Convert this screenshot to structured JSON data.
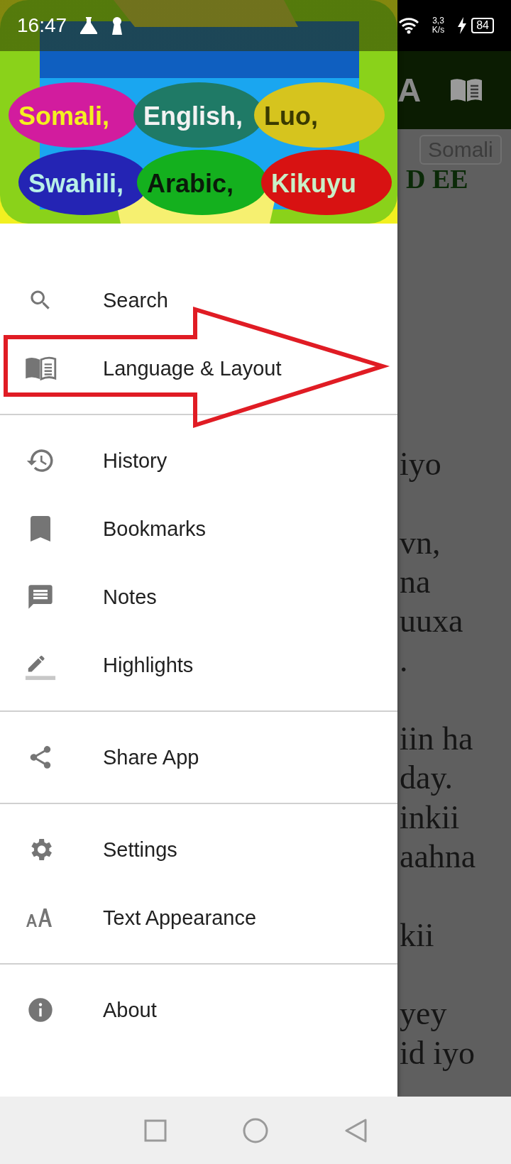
{
  "status_bar": {
    "time": "16:47",
    "net_speed": "3,3",
    "net_unit": "K/s",
    "battery": "84"
  },
  "banner": {
    "bubbles": [
      {
        "label": "Somali,",
        "color": "#d21c9e"
      },
      {
        "label": "English,",
        "color": "#1f7a66"
      },
      {
        "label": "Luo,",
        "color": "#d6c41e"
      },
      {
        "label": "Swahili,",
        "color": "#2424b4"
      },
      {
        "label": "Arabic,",
        "color": "#14b01e"
      },
      {
        "label": "Kikuyu",
        "color": "#d81212"
      }
    ]
  },
  "drawer": {
    "sections": [
      {
        "items": [
          {
            "kind": "search",
            "label": "Search"
          },
          {
            "kind": "book",
            "label": "Language & Layout"
          }
        ]
      },
      {
        "items": [
          {
            "kind": "history",
            "label": "History"
          },
          {
            "kind": "bookmark",
            "label": "Bookmarks"
          },
          {
            "kind": "notes",
            "label": "Notes"
          },
          {
            "kind": "highlight",
            "label": "Highlights"
          }
        ]
      },
      {
        "items": [
          {
            "kind": "share",
            "label": "Share App"
          }
        ]
      },
      {
        "items": [
          {
            "kind": "settings",
            "label": "Settings"
          },
          {
            "kind": "text",
            "label": "Text Appearance"
          }
        ]
      },
      {
        "items": [
          {
            "kind": "info",
            "label": "About"
          }
        ]
      }
    ]
  },
  "background_page": {
    "toolbar_letter": "A",
    "language_chip": "Somali",
    "heading": "D EE",
    "lines": [
      "iyo",
      "vn,",
      "na",
      "uuxa",
      ".",
      "iin ha",
      "day.",
      "inkii",
      "aahna",
      "kii",
      "yey",
      "id iyo"
    ]
  }
}
